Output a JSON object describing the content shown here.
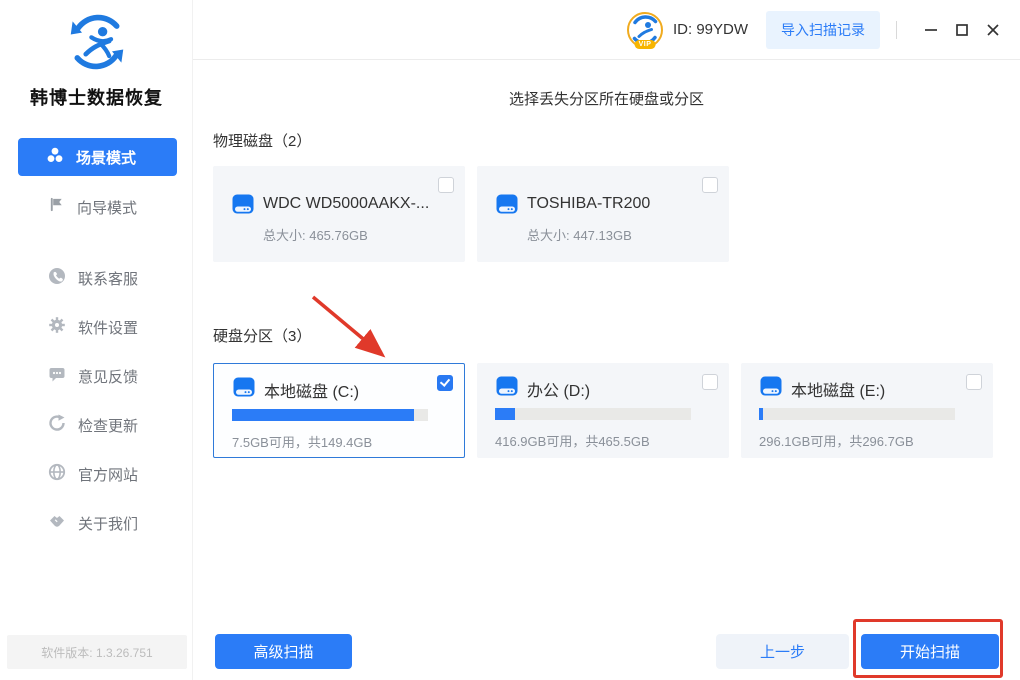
{
  "app": {
    "name": "韩博士数据恢复",
    "version": "软件版本: 1.3.26.751"
  },
  "header": {
    "vip_badge": "VIP",
    "user_id": "ID: 99YDW",
    "import_button": "导入扫描记录"
  },
  "sidebar": {
    "items": [
      {
        "label": "场景模式",
        "icon": "scene-icon",
        "active": true
      },
      {
        "label": "向导模式",
        "icon": "flag-icon",
        "active": false
      },
      {
        "label": "联系客服",
        "icon": "phone-icon",
        "active": false
      },
      {
        "label": "软件设置",
        "icon": "gear-icon",
        "active": false
      },
      {
        "label": "意见反馈",
        "icon": "feedback-icon",
        "active": false
      },
      {
        "label": "检查更新",
        "icon": "update-icon",
        "active": false
      },
      {
        "label": "官方网站",
        "icon": "globe-icon",
        "active": false
      },
      {
        "label": "关于我们",
        "icon": "about-icon",
        "active": false
      }
    ]
  },
  "main": {
    "title": "选择丢失分区所在硬盘或分区",
    "physical": {
      "label": "物理磁盘（2）",
      "cards": [
        {
          "name": "WDC WD5000AAKX-...",
          "size": "总大小: 465.76GB",
          "checked": false
        },
        {
          "name": "TOSHIBA-TR200",
          "size": "总大小: 447.13GB",
          "checked": false
        }
      ]
    },
    "partitions": {
      "label": "硬盘分区（3）",
      "cards": [
        {
          "name": "本地磁盘 (C:)",
          "info": "7.5GB可用，共149.4GB",
          "checked": true,
          "selected": true,
          "used_pct": 93
        },
        {
          "name": "办公 (D:)",
          "info": "416.9GB可用，共465.5GB",
          "checked": false,
          "selected": false,
          "used_pct": 10
        },
        {
          "name": "本地磁盘 (E:)",
          "info": "296.1GB可用，共296.7GB",
          "checked": false,
          "selected": false,
          "used_pct": 2
        }
      ]
    },
    "footer": {
      "advanced_scan": "高级扫描",
      "prev_step": "上一步",
      "start_scan": "开始扫描"
    }
  },
  "colors": {
    "primary_blue": "#2b7cf7",
    "card_bg": "#f4f6f9",
    "selected_border": "#2f7ad9",
    "annotation_red": "#e0392a",
    "vip_gold": "#f7b500"
  }
}
